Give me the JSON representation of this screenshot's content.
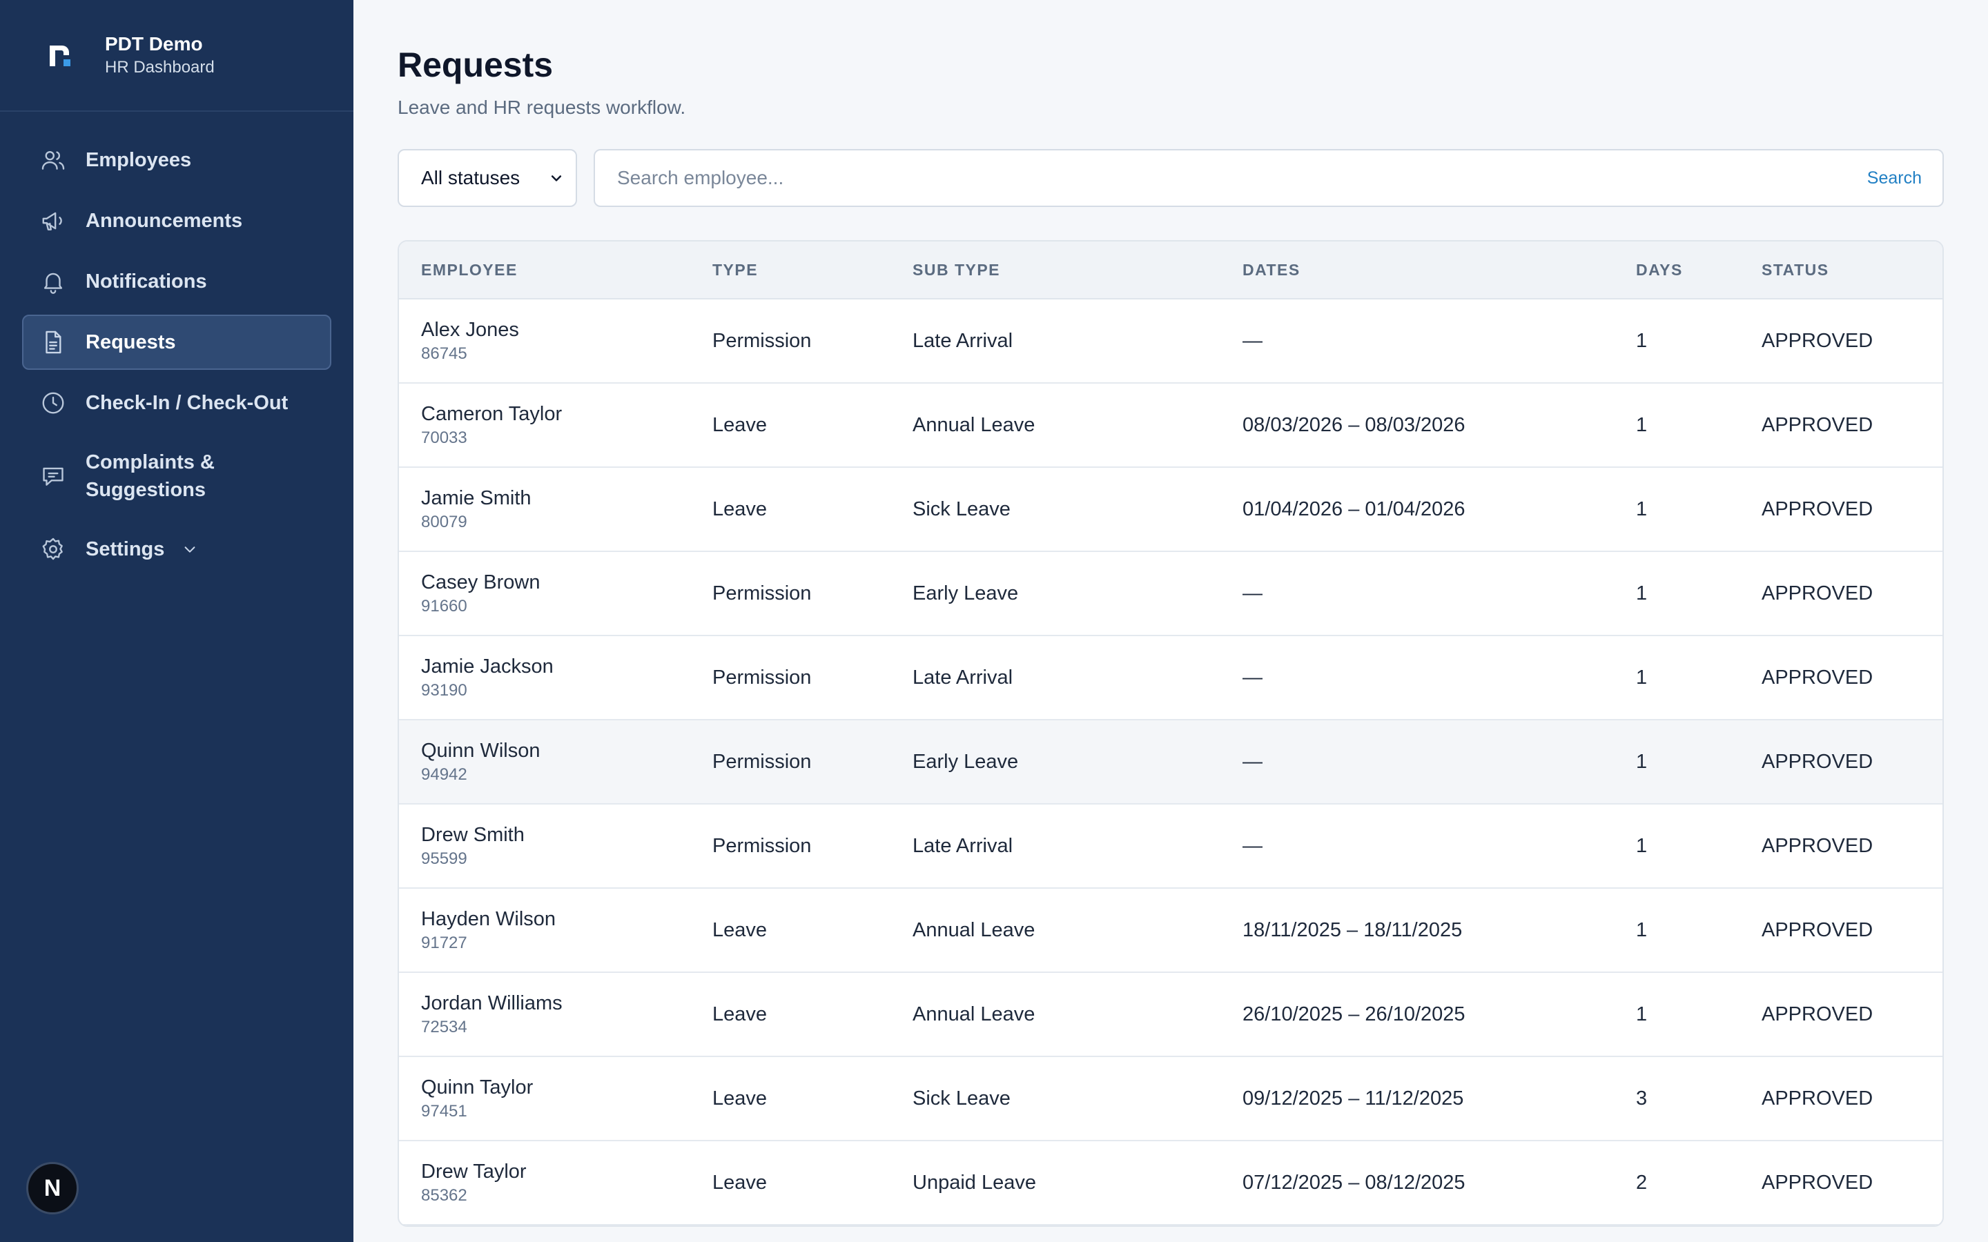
{
  "brand": {
    "name": "PDT Demo",
    "subtitle": "HR Dashboard"
  },
  "sidebar": {
    "items": [
      {
        "label": "Employees",
        "icon": "users-icon"
      },
      {
        "label": "Announcements",
        "icon": "megaphone-icon"
      },
      {
        "label": "Notifications",
        "icon": "bell-icon"
      },
      {
        "label": "Requests",
        "icon": "document-icon",
        "active": true
      },
      {
        "label": "Check-In / Check-Out",
        "icon": "clock-icon"
      },
      {
        "label": "Complaints & Suggestions",
        "icon": "chat-icon"
      },
      {
        "label": "Settings",
        "icon": "gear-icon"
      }
    ],
    "avatar_letter": "N"
  },
  "page": {
    "title": "Requests",
    "subtitle": "Leave and HR requests workflow."
  },
  "filters": {
    "status_selected": "All statuses",
    "search_placeholder": "Search employee...",
    "search_button": "Search"
  },
  "table": {
    "headers": [
      "EMPLOYEE",
      "TYPE",
      "SUB TYPE",
      "DATES",
      "DAYS",
      "STATUS"
    ],
    "rows": [
      {
        "name": "Alex Jones",
        "id": "86745",
        "type": "Permission",
        "subtype": "Late Arrival",
        "dates": "—",
        "days": "1",
        "status": "APPROVED"
      },
      {
        "name": "Cameron Taylor",
        "id": "70033",
        "type": "Leave",
        "subtype": "Annual Leave",
        "dates": "08/03/2026 – 08/03/2026",
        "days": "1",
        "status": "APPROVED"
      },
      {
        "name": "Jamie Smith",
        "id": "80079",
        "type": "Leave",
        "subtype": "Sick Leave",
        "dates": "01/04/2026 – 01/04/2026",
        "days": "1",
        "status": "APPROVED"
      },
      {
        "name": "Casey Brown",
        "id": "91660",
        "type": "Permission",
        "subtype": "Early Leave",
        "dates": "—",
        "days": "1",
        "status": "APPROVED"
      },
      {
        "name": "Jamie Jackson",
        "id": "93190",
        "type": "Permission",
        "subtype": "Late Arrival",
        "dates": "—",
        "days": "1",
        "status": "APPROVED"
      },
      {
        "name": "Quinn Wilson",
        "id": "94942",
        "type": "Permission",
        "subtype": "Early Leave",
        "dates": "—",
        "days": "1",
        "status": "APPROVED"
      },
      {
        "name": "Drew Smith",
        "id": "95599",
        "type": "Permission",
        "subtype": "Late Arrival",
        "dates": "—",
        "days": "1",
        "status": "APPROVED"
      },
      {
        "name": "Hayden Wilson",
        "id": "91727",
        "type": "Leave",
        "subtype": "Annual Leave",
        "dates": "18/11/2025 – 18/11/2025",
        "days": "1",
        "status": "APPROVED"
      },
      {
        "name": "Jordan Williams",
        "id": "72534",
        "type": "Leave",
        "subtype": "Annual Leave",
        "dates": "26/10/2025 – 26/10/2025",
        "days": "1",
        "status": "APPROVED"
      },
      {
        "name": "Quinn Taylor",
        "id": "97451",
        "type": "Leave",
        "subtype": "Sick Leave",
        "dates": "09/12/2025 – 11/12/2025",
        "days": "3",
        "status": "APPROVED"
      },
      {
        "name": "Drew Taylor",
        "id": "85362",
        "type": "Leave",
        "subtype": "Unpaid Leave",
        "dates": "07/12/2025 – 08/12/2025",
        "days": "2",
        "status": "APPROVED"
      }
    ]
  },
  "colors": {
    "sidebar_bg": "#1b3257",
    "sidebar_active": "#2f4a73",
    "page_bg": "#f5f7fa",
    "accent": "#2280c4"
  }
}
